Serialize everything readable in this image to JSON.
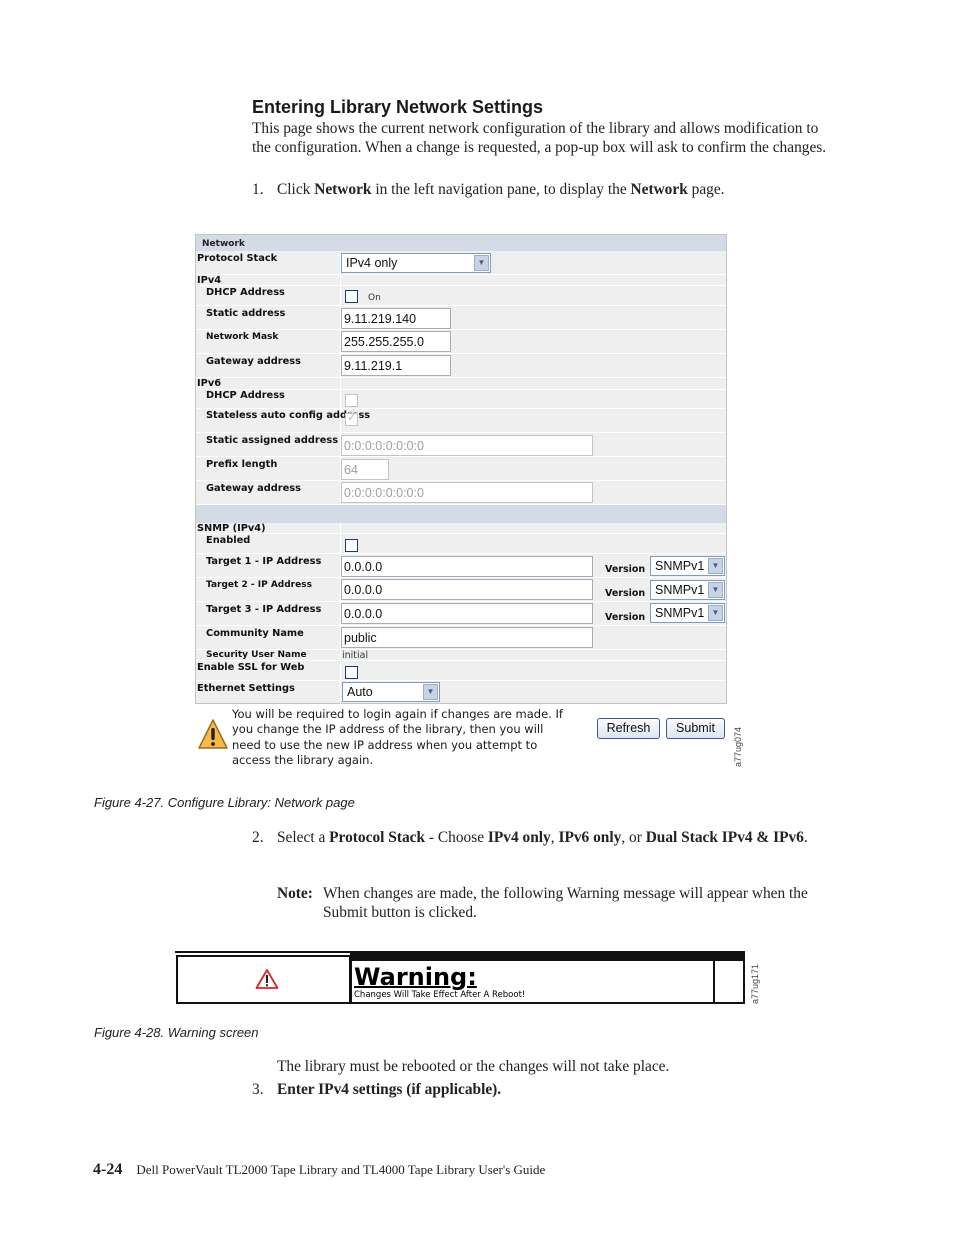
{
  "section": {
    "title": "Entering Library Network Settings",
    "intro": "This page shows the current network configuration of the library and allows modification to the configuration. When a change is requested, a pop-up box will ask to confirm the changes."
  },
  "steps": {
    "step1": {
      "num": "1.",
      "pre": "Click ",
      "b1": "Network",
      "mid": " in the left navigation pane, to display the ",
      "b2": "Network",
      "post": " page."
    },
    "step2": {
      "num": "2.",
      "pre": "Select a ",
      "b1": "Protocol Stack",
      "mid1": " - Choose ",
      "b2": "IPv4 only",
      "mid2": ", ",
      "b3": "IPv6 only",
      "mid3": ", or ",
      "b4": "Dual Stack IPv4 & IPv6",
      "post": "."
    },
    "note": {
      "label": "Note:",
      "text": "When changes are made, the following Warning message will appear when the Submit button is clicked."
    },
    "after_warning": "The library must be rebooted or the changes will not take place.",
    "step3": {
      "num": "3.",
      "text": "Enter IPv4 settings (if applicable)."
    }
  },
  "network_form": {
    "header": "Network",
    "protocol_stack": {
      "label": "Protocol Stack",
      "value": "IPv4 only"
    },
    "ipv4": {
      "heading": "IPv4",
      "dhcp": {
        "label": "DHCP Address",
        "checked": false,
        "option_label": "On"
      },
      "static_address": {
        "label": "Static address",
        "value": "9.11.219.140"
      },
      "network_mask": {
        "label": "Network Mask",
        "value": "255.255.255.0"
      },
      "gateway": {
        "label": "Gateway address",
        "value": "9.11.219.1"
      }
    },
    "ipv6": {
      "heading": "IPv6",
      "dhcp": {
        "label": "DHCP Address",
        "checked": false
      },
      "stateless": {
        "label": "Stateless auto config address",
        "checked": true
      },
      "static_assigned": {
        "label": "Static assigned address",
        "value": "0:0:0:0:0:0:0:0"
      },
      "prefix_length": {
        "label": "Prefix length",
        "value": "64"
      },
      "gateway": {
        "label": "Gateway address",
        "value": "0:0:0:0:0:0:0:0"
      }
    },
    "snmp": {
      "heading": "SNMP (IPv4)",
      "enabled": {
        "label": "Enabled",
        "checked": false
      },
      "targets": [
        {
          "label": "Target 1 - IP Address",
          "value": "0.0.0.0",
          "version_label": "Version",
          "version": "SNMPv1"
        },
        {
          "label": "Target 2 - IP Address",
          "value": "0.0.0.0",
          "version_label": "Version",
          "version": "SNMPv1"
        },
        {
          "label": "Target 3 - IP Address",
          "value": "0.0.0.0",
          "version_label": "Version",
          "version": "SNMPv1"
        }
      ],
      "community": {
        "label": "Community Name",
        "value": "public"
      },
      "security_user": {
        "label": "Security User Name",
        "value": "initial"
      }
    },
    "ssl": {
      "label": "Enable SSL for Web",
      "checked": false
    },
    "ethernet": {
      "label": "Ethernet Settings",
      "value": "Auto"
    },
    "warning_text": "You will be required to login again if changes are made. If you change the IP address of the library, then you will need to use the new IP address when you attempt to access the library again.",
    "buttons": {
      "refresh": "Refresh",
      "submit": "Submit"
    },
    "figure_id": "a77ug074"
  },
  "figure1_caption": "Figure 4-27. Configure Library: Network page",
  "warning_screen": {
    "title": "Warning:",
    "subtitle": "Changes Will Take Effect After A Reboot!",
    "figure_id": "a77ug171",
    "icon_color": "#e0202a"
  },
  "figure2_caption": "Figure 4-28. Warning screen",
  "footer": {
    "page_number": "4-24",
    "book_title": "Dell PowerVault TL2000 Tape Library and TL4000 Tape Library User's Guide"
  }
}
